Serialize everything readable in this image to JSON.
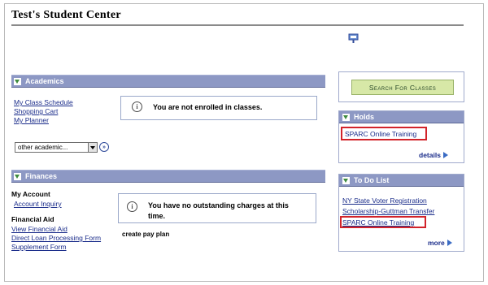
{
  "page": {
    "title": "Test's Student Center"
  },
  "academics": {
    "header": "Academics",
    "links": [
      "My Class Schedule",
      "Shopping Cart",
      "My Planner"
    ],
    "message": "You are not enrolled in classes.",
    "select_value": "other academic...",
    "go_label": "»"
  },
  "finances": {
    "header": "Finances",
    "my_account_label": "My Account",
    "account_inquiry": "Account Inquiry",
    "financial_aid_label": "Financial Aid",
    "aid_links": [
      "View Financial Aid",
      "Direct Loan Processing Form",
      "Supplement Form"
    ],
    "message": "You have no outstanding charges at this time.",
    "create_pay_plan": "create pay plan"
  },
  "sidebar": {
    "search_button": "Search For Classes",
    "holds": {
      "header": "Holds",
      "item": "SPARC Online Training",
      "details": "details"
    },
    "todo": {
      "header": "To Do List",
      "items": [
        "NY State Voter Registration",
        "Scholarship-Guttman Transfer",
        "SPARC Online Training"
      ],
      "more": "more"
    }
  },
  "icons": {
    "info": "i",
    "message": "message-icon",
    "play": "play-arrow-icon"
  },
  "colors": {
    "header_bg": "#8d98c4",
    "link": "#1a2c8a",
    "search_button_bg": "#d7e8a7",
    "highlight": "#d2232a"
  }
}
